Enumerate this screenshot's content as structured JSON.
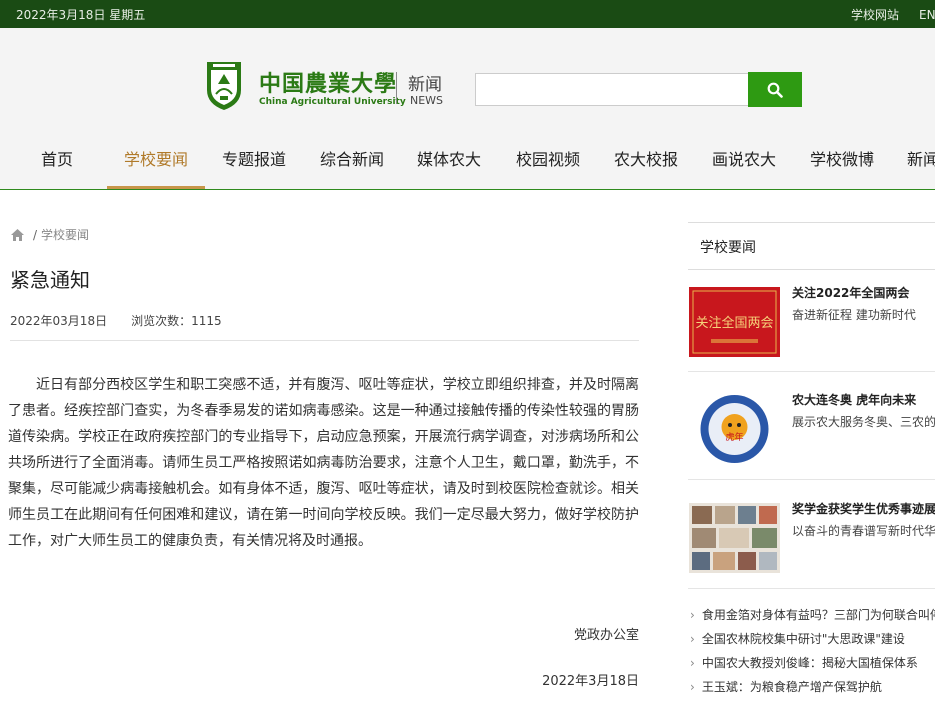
{
  "topbar": {
    "date": "2022年3月18日 星期五",
    "links": [
      "学校网站",
      "ENG"
    ]
  },
  "header": {
    "name_cn": "中国農業大學",
    "name_en": "China Agricultural University",
    "news_cn": "新闻",
    "news_en": "NEWS",
    "search_placeholder": ""
  },
  "nav": {
    "items": [
      "首页",
      "学校要闻",
      "专题报道",
      "综合新闻",
      "媒体农大",
      "校园视频",
      "农大校报",
      "画说农大",
      "学校微博",
      "新闻"
    ],
    "active_index": 1
  },
  "breadcrumb": {
    "sep": "/",
    "current": "学校要闻"
  },
  "article": {
    "title": "紧急通知",
    "date": "2022年03月18日",
    "views": "浏览次数：1115",
    "body": "近日有部分西校区学生和职工突感不适，并有腹泻、呕吐等症状，学校立即组织排查，并及时隔离了患者。经疾控部门查实，为冬春季易发的诺如病毒感染。这是一种通过接触传播的传染性较强的胃肠道传染病。学校正在政府疾控部门的专业指导下，启动应急预案，开展流行病学调查，对涉病场所和公共场所进行了全面消毒。请师生员工严格按照诺如病毒防治要求，注意个人卫生，戴口罩，勤洗手，不聚集，尽可能减少病毒接触机会。如有身体不适，腹泻、呕吐等症状，请及时到校医院检查就诊。相关师生员工在此期间有任何困难和建议，请在第一时间向学校反映。我们一定尽最大努力，做好学校防护工作，对广大师生员工的健康负责，有关情况将及时通报。",
    "signature": "党政办公室",
    "sign_date": "2022年3月18日"
  },
  "sidebar": {
    "heading": "学校要闻",
    "cards": [
      {
        "title": "关注2022年全国两会",
        "subtitle": "奋进新征程 建功新时代",
        "img_text": "关注全国两会"
      },
      {
        "title": "农大连冬奥 虎年向未来",
        "subtitle": "展示农大服务冬奥、三农的",
        "img_text": "虎年"
      },
      {
        "title": "奖学金获奖学生优秀事迹展",
        "subtitle": "以奋斗的青春谱写新时代华"
      }
    ],
    "list": [
      "食用金箔对身体有益吗？三部门为何联合叫停",
      "全国农林院校集中研讨\"大思政课\"建设",
      "中国农大教授刘俊峰：揭秘大国植保体系",
      "王玉斌：为粮食稳产增产保驾护航"
    ],
    "list_arrow": "›"
  },
  "colors": {
    "topbar": "#1a4b14",
    "brand_green": "#2e9a12",
    "nav_active": "#b07a2a"
  }
}
